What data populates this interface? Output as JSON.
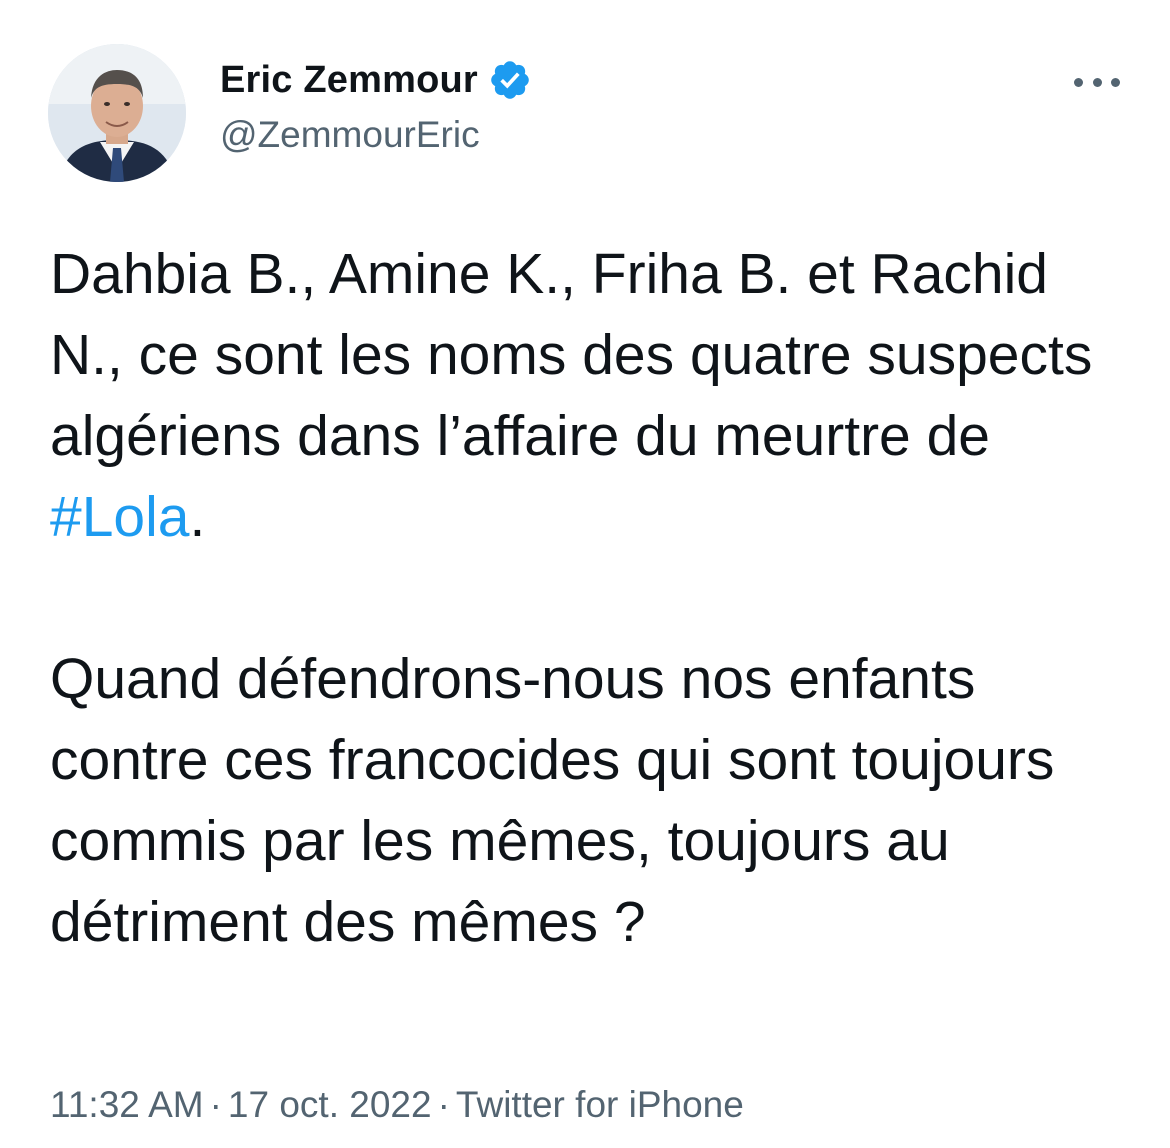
{
  "tweet": {
    "author": {
      "name": "Eric Zemmour",
      "handle": "@ZemmourEric",
      "verified": true
    },
    "body": {
      "p1_before": "Dahbia B., Amine K., Friha B. et Rachid N., ce sont les noms des quatre suspects algériens dans l’affaire du meurtre de ",
      "p1_hashtag": "#Lola",
      "p1_after": ".",
      "p2": "Quand défendrons-nous nos enfants contre ces francocides qui sont toujours commis par les mêmes, toujours au détriment des mêmes ?"
    },
    "meta": {
      "time": "11:32 AM",
      "separator": "·",
      "date": "17 oct. 2022",
      "source": "Twitter for iPhone"
    }
  },
  "icons": {
    "verified": "verified-badge-icon",
    "more": "more-options-icon"
  },
  "colors": {
    "text": "#0f1419",
    "secondary": "#536471",
    "link": "#1d9bf0"
  }
}
